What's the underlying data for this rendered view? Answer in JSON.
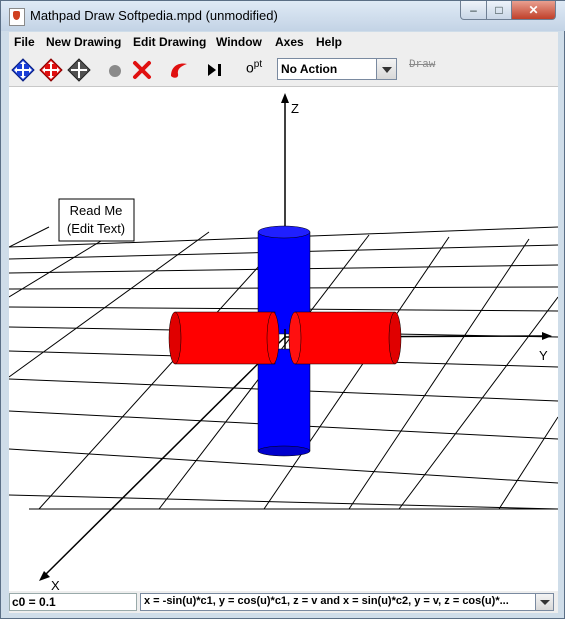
{
  "window": {
    "title": "Mathpad Draw Softpedia.mpd (unmodified)"
  },
  "menu": [
    "File",
    "New Drawing",
    "Edit Drawing",
    "Window",
    "Axes",
    "Help"
  ],
  "toolbar": {
    "opt_label": "o",
    "opt_sup": "pt",
    "action_select": "No Action",
    "draw_label": "Draw"
  },
  "canvas": {
    "note_line1": "Read Me",
    "note_line2": "(Edit Text)",
    "axis_z": "Z",
    "axis_y": "Y",
    "axis_x": "X"
  },
  "status": {
    "variable": "c0 = 0.1",
    "equation": "x = -sin(u)*c1, y = cos(u)*c1, z = v and x = sin(u)*c2, y = v, z = cos(u)*..."
  },
  "colors": {
    "cylinder_red": "#ff0000",
    "cylinder_blue": "#0000ff"
  }
}
